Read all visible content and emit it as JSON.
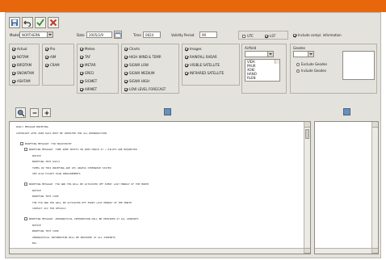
{
  "form": {
    "model_label": "Model",
    "model_value": "NORTHERN",
    "date_label": "Date",
    "date_value": "2005/2/9",
    "time_label": "Time",
    "time_value": "0824",
    "validity_label": "Validity Period",
    "validity_value": "99",
    "utc_label": "UTC",
    "utc_checked": false,
    "lst_label": "LST",
    "lst_checked": true,
    "include_label": "Include compl. information",
    "include_checked": true
  },
  "groups": {
    "actual": [
      {
        "label": "Actual",
        "checked": true
      },
      {
        "label": "NOTAM",
        "checked": true
      },
      {
        "label": "BIRDTAM",
        "checked": true
      },
      {
        "label": "SNOWTAM",
        "checked": true
      },
      {
        "label": "ASHTAM",
        "checked": true
      }
    ],
    "pro": [
      {
        "label": "Pro",
        "checked": true
      },
      {
        "label": "AIM",
        "checked": true
      },
      {
        "label": "CRAM",
        "checked": true
      }
    ],
    "meteo": [
      {
        "label": "Meteo",
        "checked": true
      },
      {
        "label": "TAF",
        "checked": true
      },
      {
        "label": "METAR",
        "checked": true
      },
      {
        "label": "SPECI",
        "checked": true
      },
      {
        "label": "SIGMET",
        "checked": true
      },
      {
        "label": "AIRMET",
        "checked": true
      }
    ],
    "charts": [
      {
        "label": "Charts",
        "checked": true
      },
      {
        "label": "HIGH WIND & TEMP.",
        "checked": true
      },
      {
        "label": "SIGWX LOW",
        "checked": true
      },
      {
        "label": "SIGWX MEDIUM",
        "checked": true
      },
      {
        "label": "SIGWX HIGH",
        "checked": true
      },
      {
        "label": "LOW LEVEL FORECAST",
        "checked": true
      }
    ],
    "images": [
      {
        "label": "Images",
        "checked": true
      },
      {
        "label": "RAINFALL RADAR",
        "checked": true
      },
      {
        "label": "VISIBLE SATELLITE",
        "checked": true
      },
      {
        "label": "INFRARED SATELLITE",
        "checked": true
      }
    ],
    "airfield": {
      "label": "Airfield",
      "items": [
        "VIDA",
        "PAUK",
        "XOKI",
        "HANO",
        "RLEN"
      ]
    },
    "geodes": {
      "label": "Geodes",
      "options": [
        {
          "label": "Exclude Geodes",
          "checked": false
        },
        {
          "label": "Include Geodes",
          "checked": false
        }
      ]
    }
  },
  "messages": [
    {
      "indent": 0,
      "text": "DAILY MESSAGE BRIEFING"
    },
    {
      "indent": 0,
      "text": "COPYRIGHT AFTN 2005 DATA MUST BE CREDITED FOR ALL REPRODUCTION"
    },
    {
      "indent": 1,
      "toggle": "-",
      "text": "BRIEFING MESSAGE: FIR MAASTRICHT"
    },
    {
      "indent": 2,
      "toggle": "-",
      "text": "BRIEFING MESSAGE: TIME ZONE SHIFTS ON 2005 MARCH 27 / PILOTS ARE REQUESTED"
    },
    {
      "indent": 4,
      "text": "NOTICE"
    },
    {
      "indent": 4,
      "text": "BRIEFING TEXT DAILY"
    },
    {
      "indent": 4,
      "text": "TIMES IN THIS BRIEFING ARE UTC UNLESS OTHERWISE STATED"
    },
    {
      "indent": 4,
      "text": "SEE ALSO FLIGHT PLAN REQUIREMENTS"
    },
    {
      "indent": 2,
      "toggle": "-",
      "text": "BRIEFING MESSAGE: FIR AND TMA WILL BE ACTIVATED OFF EVERY LAST MONDAY OF THE MONTH"
    },
    {
      "indent": 4,
      "text": "NOTICE"
    },
    {
      "indent": 4,
      "text": "BRIEFING TEXT CODE"
    },
    {
      "indent": 4,
      "text": "THE FIR AND TMA WILL BE ACTIVATED OFF EVERY LAST MONDAY OF THE MONTH"
    },
    {
      "indent": 4,
      "text": "CONTACT ACC FOR DETAILS"
    },
    {
      "indent": 2,
      "toggle": "-",
      "text": "BRIEFING MESSAGE: AERONAUTICAL INFORMATION WILL BE PROVIDED AT ALL AIRPORTS"
    },
    {
      "indent": 4,
      "text": "NOTICE"
    },
    {
      "indent": 4,
      "text": "BRIEFING TEXT CODE"
    },
    {
      "indent": 4,
      "text": "AERONAUTICAL INFORMATION WILL BE PROVIDED AT ALL AIRPORTS"
    },
    {
      "indent": 4,
      "text": "NIL"
    }
  ],
  "colors": {
    "header_bar": "#e8670d",
    "window_bg": "#e4e2dc",
    "save_icon": "#3a6ea5",
    "check_icon": "#2e8b2e",
    "close_icon": "#c0392b"
  },
  "icons": {
    "toolbar": [
      "save-icon",
      "undo-icon",
      "check-icon",
      "close-icon"
    ],
    "zoom": [
      "magnifier-icon",
      "minus-icon",
      "plus-icon"
    ]
  }
}
